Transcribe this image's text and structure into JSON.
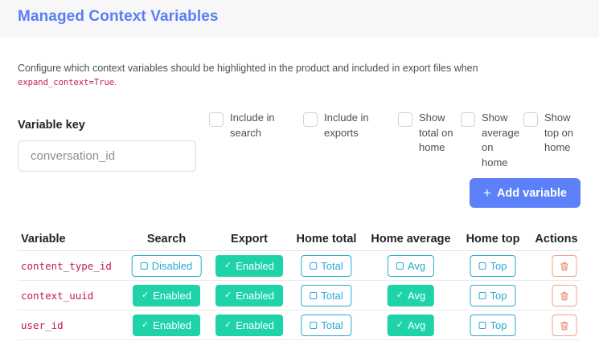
{
  "page": {
    "title": "Managed Context Variables"
  },
  "description": {
    "text": "Configure which context variables should be highlighted in the product and included in export files when",
    "code": "expand_context=True",
    "trailing": "."
  },
  "form": {
    "variable_key_label": "Variable key",
    "variable_key_placeholder": "conversation_id",
    "options": [
      {
        "line1": "Include in",
        "line2": "search",
        "line3": "",
        "line4": "",
        "checked": false
      },
      {
        "line1": "Include in",
        "line2": "exports",
        "line3": "",
        "line4": "",
        "checked": false
      },
      {
        "line1": "Show",
        "line2": "total on",
        "line3": "home",
        "line4": "",
        "checked": false
      },
      {
        "line1": "Show",
        "line2": "average",
        "line3": "on",
        "line4": "home",
        "checked": false
      },
      {
        "line1": "Show",
        "line2": "top on",
        "line3": "home",
        "line4": "",
        "checked": false
      }
    ],
    "add_button_label": "Add variable",
    "add_button_icon": "+"
  },
  "table": {
    "headers": {
      "variable": "Variable",
      "search": "Search",
      "export": "Export",
      "home_total": "Home total",
      "home_average": "Home average",
      "home_top": "Home top",
      "actions": "Actions"
    },
    "rows": [
      {
        "name": "content_type_id",
        "search": {
          "label": "Disabled",
          "enabled": false
        },
        "export": {
          "label": "Enabled",
          "enabled": true
        },
        "total": {
          "label": "Total",
          "enabled": false
        },
        "avg": {
          "label": "Avg",
          "enabled": false
        },
        "top": {
          "label": "Top",
          "enabled": false
        }
      },
      {
        "name": "context_uuid",
        "search": {
          "label": "Enabled",
          "enabled": true
        },
        "export": {
          "label": "Enabled",
          "enabled": true
        },
        "total": {
          "label": "Total",
          "enabled": false
        },
        "avg": {
          "label": "Avg",
          "enabled": true
        },
        "top": {
          "label": "Top",
          "enabled": false
        }
      },
      {
        "name": "user_id",
        "search": {
          "label": "Enabled",
          "enabled": true
        },
        "export": {
          "label": "Enabled",
          "enabled": true
        },
        "total": {
          "label": "Total",
          "enabled": false
        },
        "avg": {
          "label": "Avg",
          "enabled": true
        },
        "top": {
          "label": "Top",
          "enabled": false
        }
      }
    ]
  },
  "colors": {
    "accent": "#5a7ef6",
    "enabled": "#1fd3a9",
    "disabled_outline": "#29a9d6",
    "danger": "#f0a089",
    "code": "#c2185b"
  },
  "icons": {
    "check": "check-icon",
    "square": "square-icon",
    "trash": "trash-icon",
    "plus": "plus-icon"
  }
}
